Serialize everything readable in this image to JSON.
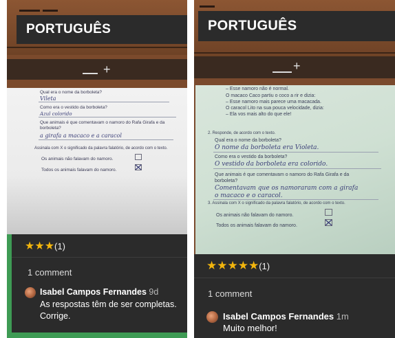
{
  "posts": [
    {
      "title": "PORTUGUÊS",
      "add_symbol": "+",
      "worksheet": {
        "q1": "Qual era o nome da borboleta?",
        "a1": "Vileta",
        "q2": "Como era o vestido da borboleta?",
        "a2": "Azul colorido",
        "q3a": "Que animais é que comentavam o namoro do Rafa Girafa e da",
        "q3b": "borboleta?",
        "a3": "a girafa a macaco e a caracol",
        "q4": "Assinala com X o significado da palavra falatório, de acordo com o texto.",
        "opt1": "Os animais não falavam do namoro.",
        "opt2": "Todos os animais falavam do namoro."
      },
      "rating": {
        "stars": "★★★",
        "count": "(1)",
        "value": 3
      },
      "comments_count": "1 comment",
      "comment": {
        "author": "Isabel Campos Fernandes",
        "time": "9d",
        "text": "As respostas têm de ser completas. Corrige."
      }
    },
    {
      "title": "PORTUGUÊS",
      "add_symbol": "+",
      "worksheet": {
        "l1": "– Esse namoro não é normal.",
        "l2": "O macaco Caco partiu o coco a rir e dizia:",
        "l3": "– Esse namoro mais parece uma macacada.",
        "l4": "O caracol Lito na sua pouca velocidade, dizia:",
        "l5": "– Ela vos mais alto do que ele!",
        "q2": "2. Responde, de acordo com o texto.",
        "q2a": "Qual era o nome da borboleta?",
        "a2a": "O nome da borboleta era Violeta.",
        "q2b": "Como era o vestido da borboleta?",
        "a2b": "O vestido da borboleta era colorido.",
        "q2c": "Que animais é que comentavam o namoro do Rafa Girafa e da",
        "q2d": "borboleta?",
        "a2c": "Comentavam que os namoraram com a girafa",
        "a2d": "o macaco e o caracol.",
        "q3": "3. Assinala com X o significado da palavra falatório, de acordo com o texto.",
        "opt1": "Os animais não falavam do namoro.",
        "opt2": "Todos os animais falavam do namoro."
      },
      "rating": {
        "stars": "★★★★★",
        "count": "(1)",
        "value": 5
      },
      "comments_count": "1 comment",
      "comment": {
        "author": "Isabel Campos Fernandes",
        "time": "1m",
        "text": "Muito melhor!"
      }
    }
  ]
}
